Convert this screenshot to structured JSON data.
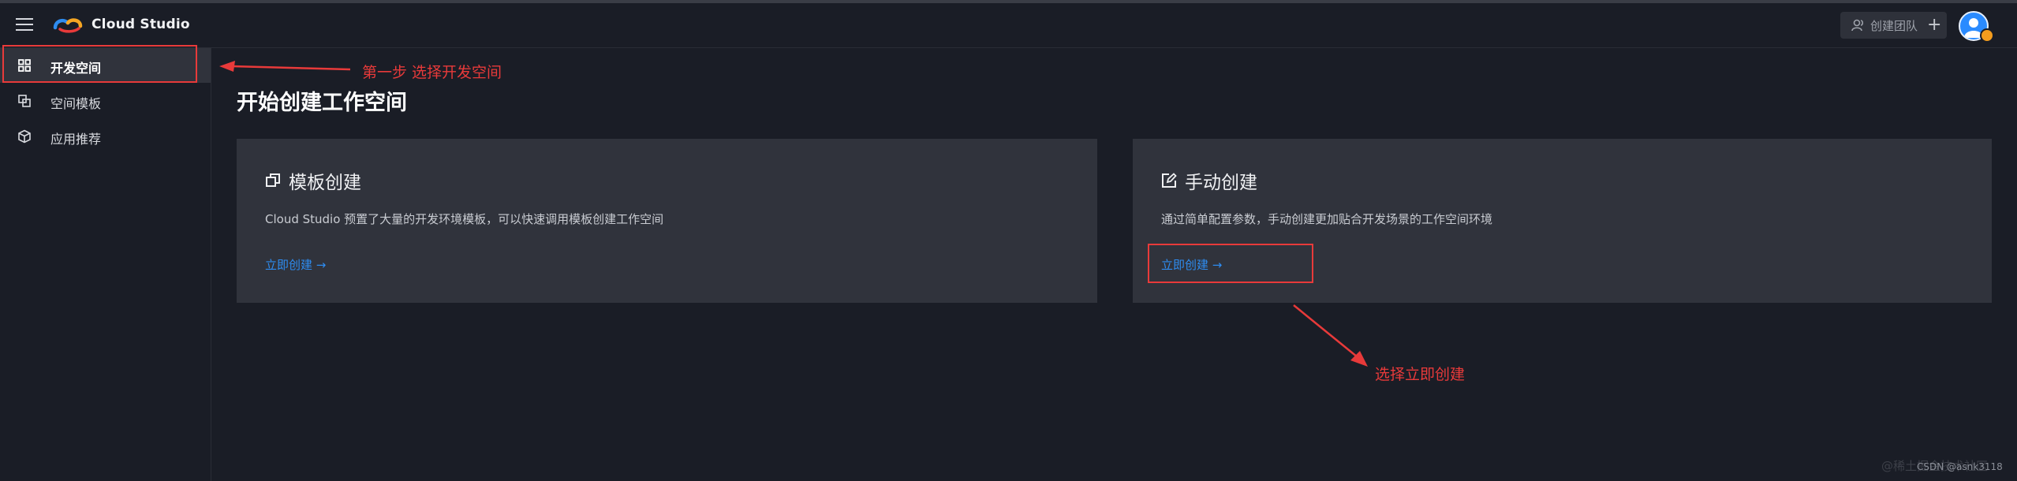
{
  "header": {
    "brand": "Cloud Studio",
    "team_button_label": "创建团队"
  },
  "sidebar": {
    "items": [
      {
        "label": "开发空间",
        "icon": "grid-icon",
        "active": true
      },
      {
        "label": "空间模板",
        "icon": "template-icon",
        "active": false
      },
      {
        "label": "应用推荐",
        "icon": "cube-icon",
        "active": false
      }
    ]
  },
  "main": {
    "title": "开始创建工作空间",
    "cards": [
      {
        "icon": "copy-icon",
        "title": "模板创建",
        "description": "Cloud Studio 预置了大量的开发环境模板，可以快速调用模板创建工作空间",
        "link": "立即创建 →"
      },
      {
        "icon": "edit-icon",
        "title": "手动创建",
        "description": "通过简单配置参数，手动创建更加贴合开发场景的工作空间环境",
        "link": "立即创建 →"
      }
    ]
  },
  "annotations": {
    "step1": "第一步 选择开发空间",
    "step2": "选择立即创建",
    "color": "#e83a3a"
  },
  "watermark": {
    "faint": "@稀土掘金技术社区",
    "credit": "CSDN @asnk3118"
  },
  "colors": {
    "background": "#1a1d26",
    "card": "#30333c",
    "link": "#2e8cf0"
  }
}
